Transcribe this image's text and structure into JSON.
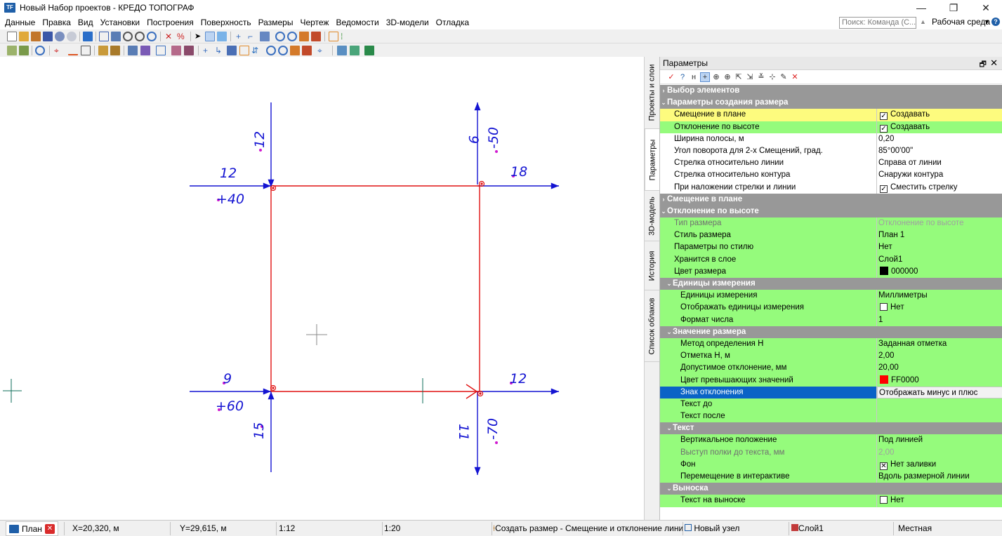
{
  "window": {
    "title": "Новый Набор проектов - КРЕДО ТОПОГРАФ",
    "app_icon": "TF",
    "minimize": "—",
    "restore": "❐",
    "close": "✕"
  },
  "menu": {
    "items": [
      "Данные",
      "Правка",
      "Вид",
      "Установки",
      "Построения",
      "Поверхность",
      "Размеры",
      "Чертеж",
      "Ведомости",
      "3D-модели",
      "Отладка"
    ],
    "search_placeholder": "Поиск: Команда (С...",
    "workspace_label": "Рабочая среда",
    "help": "?"
  },
  "canvas": {
    "labels": {
      "tl_top": "12",
      "tl_left": "12",
      "tl_elev": "+40",
      "tr_top": "9",
      "tr_dev": "-50",
      "tr_right": "18",
      "bl_left": "9",
      "bl_elev": "+60",
      "bl_bottom": "15",
      "br_right": "12",
      "br_bottom": "11",
      "br_dev": "-70"
    },
    "colors": {
      "contour": "#e01010",
      "dimension": "#1414d2",
      "point": "#d01ad0",
      "crosshair": "#888888",
      "marker": "#0e6e5a"
    }
  },
  "side_tabs": [
    {
      "label": "Проекты и слои"
    },
    {
      "label": "Параметры"
    },
    {
      "label": "3D-модель"
    },
    {
      "label": "История"
    },
    {
      "label": "Список облаков"
    }
  ],
  "panel": {
    "title": "Параметры",
    "pin": "🗗",
    "close": "✕",
    "rows": [
      {
        "type": "cat",
        "label": "Выбор элементов",
        "chev": "›"
      },
      {
        "type": "cat",
        "label": "Параметры создания размера",
        "chev": "⌄"
      },
      {
        "type": "yellow",
        "label": "Смещение в плане",
        "value": "Создавать",
        "check": "✓"
      },
      {
        "type": "green",
        "label": "Отклонение по высоте",
        "value": "Создавать",
        "check": "✓"
      },
      {
        "type": "white",
        "label": "Ширина полосы, м",
        "value": "0,20"
      },
      {
        "type": "white",
        "label": "Угол поворота для 2-х Смещений, град.",
        "value": " 85°00'00\""
      },
      {
        "type": "white",
        "label": "Стрелка относительно линии",
        "value": "Справа от линии"
      },
      {
        "type": "white",
        "label": "Стрелка относительно контура",
        "value": "Снаружи контура"
      },
      {
        "type": "white",
        "label": "При наложении стрелки и линии",
        "value": "Сместить стрелку",
        "check": "✓"
      },
      {
        "type": "cat",
        "label": "Смещение в плане",
        "chev": "›"
      },
      {
        "type": "cat",
        "label": "Отклонение по высоте",
        "chev": "⌄"
      },
      {
        "type": "green",
        "label": "Тип размера",
        "value": "Отклонение по высоте",
        "disabled": true
      },
      {
        "type": "green",
        "label": "Стиль размера",
        "value": "План 1"
      },
      {
        "type": "green",
        "label": "Параметры по стилю",
        "value": "Нет"
      },
      {
        "type": "green",
        "label": "Хранится в слое",
        "value": "Слой1"
      },
      {
        "type": "green",
        "label": "Цвет размера",
        "value": "000000",
        "swatch": "#000000"
      },
      {
        "type": "subcat",
        "label": "Единицы измерения",
        "chev": "⌄"
      },
      {
        "type": "green",
        "indent": 1,
        "label": "Единицы измерения",
        "value": "Миллиметры"
      },
      {
        "type": "green",
        "indent": 1,
        "label": "Отображать единицы измерения",
        "value": "Нет",
        "check": ""
      },
      {
        "type": "green",
        "indent": 1,
        "label": "Формат числа",
        "value": "1"
      },
      {
        "type": "subcat",
        "label": "Значение размера",
        "chev": "⌄"
      },
      {
        "type": "green",
        "indent": 1,
        "label": "Метод определения H",
        "value": "Заданная отметка"
      },
      {
        "type": "green",
        "indent": 1,
        "label": "Отметка H, м",
        "value": "2,00"
      },
      {
        "type": "green",
        "indent": 1,
        "label": "Допустимое отклонение, мм",
        "value": "20,00"
      },
      {
        "type": "green",
        "indent": 1,
        "label": "Цвет превышающих значений",
        "value": "FF0000",
        "swatch": "#ff0000"
      },
      {
        "type": "selected",
        "indent": 1,
        "label": "Знак отклонения",
        "value": "Отображать минус и плюс"
      },
      {
        "type": "green",
        "indent": 1,
        "label": "Текст до",
        "value": ""
      },
      {
        "type": "green",
        "indent": 1,
        "label": "Текст после",
        "value": ""
      },
      {
        "type": "subcat",
        "label": "Текст",
        "chev": "⌄"
      },
      {
        "type": "green",
        "indent": 1,
        "label": "Вертикальное положение",
        "value": "Под линией"
      },
      {
        "type": "green",
        "indent": 1,
        "label": "Выступ полки до текста, мм",
        "value": "2,00",
        "disabled": true
      },
      {
        "type": "green",
        "indent": 1,
        "label": "Фон",
        "value": "Нет заливки",
        "check": "✕"
      },
      {
        "type": "green",
        "indent": 1,
        "label": "Перемещение в интерактиве",
        "value": "Вдоль размерной линии"
      },
      {
        "type": "subcat",
        "label": "Выноска",
        "chev": "⌄"
      },
      {
        "type": "green",
        "indent": 1,
        "label": "Текст на выноске",
        "value": "Нет",
        "check": ""
      }
    ]
  },
  "status": {
    "tab_label": "План",
    "tab_close": "✕",
    "x": "X=20,320, м",
    "y": "Y=29,615, м",
    "scale1": "1:12",
    "scale2": "1:20",
    "command": "Создать размер - Смещение и отклонение линии",
    "node": "Новый узел",
    "layer": "Слой1",
    "system": "Местная"
  }
}
